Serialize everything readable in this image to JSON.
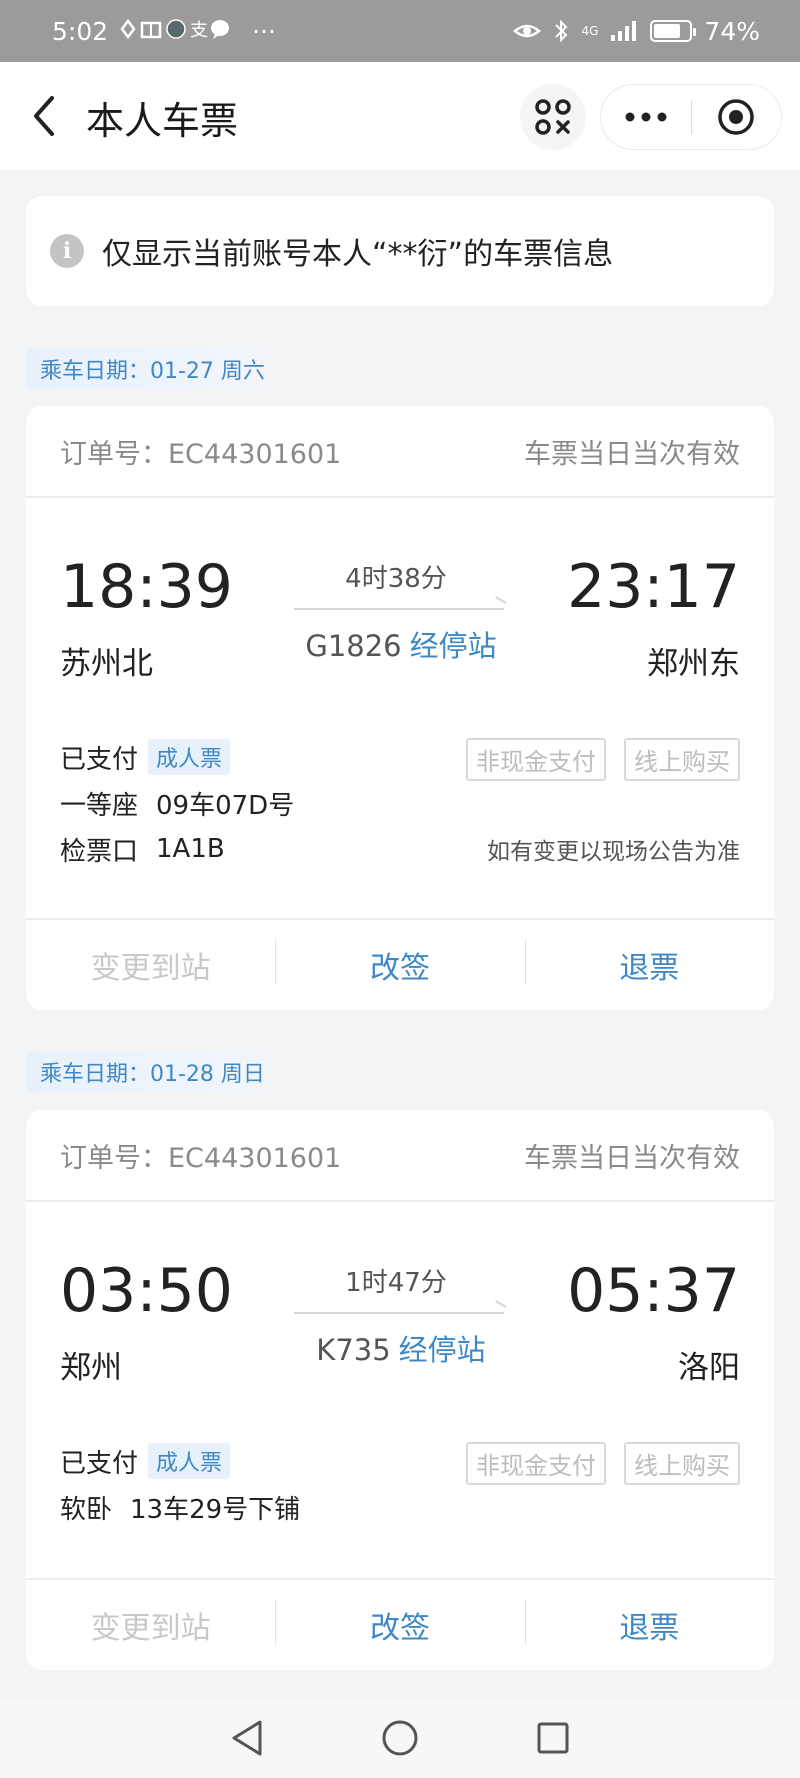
{
  "status_bar": {
    "time": "5:02",
    "more": "···",
    "network": "4G",
    "battery_percent": "74%",
    "battery_level": 0.74
  },
  "header": {
    "title": "本人车票",
    "back_icon": "chevron-left-icon",
    "scan_icon": "scan-icon",
    "more_icon": "more-dots-icon",
    "close_icon": "target-close-icon"
  },
  "notice": {
    "text": "仅显示当前账号本人“**衍”的车票信息"
  },
  "tickets": [
    {
      "date": "乘车日期：01-27 周六",
      "order_no": "订单号：EC44301601",
      "validity": "车票当日当次有效",
      "dep_time": "18:39",
      "arr_time": "23:17",
      "duration": "4时38分",
      "train_no": "G1826",
      "stops_label": "经停站",
      "dep_station": "苏州北",
      "arr_station": "郑州东",
      "pay_status": "已支付",
      "ticket_type": "成人票",
      "pay_tags": [
        "非现金支付",
        "线上购买"
      ],
      "seat_class": "一等座",
      "seat_no": "09车07D号",
      "gate_label": "检票口",
      "gate": "1A1B",
      "gate_note": "如有变更以现场公告为准",
      "actions": [
        "变更到站",
        "改签",
        "退票"
      ]
    },
    {
      "date": "乘车日期：01-28 周日",
      "order_no": "订单号：EC44301601",
      "validity": "车票当日当次有效",
      "dep_time": "03:50",
      "arr_time": "05:37",
      "duration": "1时47分",
      "train_no": "K735",
      "stops_label": "经停站",
      "dep_station": "郑州",
      "arr_station": "洛阳",
      "pay_status": "已支付",
      "ticket_type": "成人票",
      "pay_tags": [
        "非现金支付",
        "线上购买"
      ],
      "seat_class": "软卧",
      "seat_no": "13车29号下铺",
      "actions": [
        "变更到站",
        "改签",
        "退票"
      ]
    }
  ],
  "nav_bar": {
    "back_icon": "nav-back-triangle-icon",
    "home_icon": "nav-home-circle-icon",
    "recents_icon": "nav-recents-square-icon"
  },
  "colors": {
    "accent": "#3f88c8",
    "status_bar_bg": "#9b9b9b",
    "page_bg": "#f3f4f6"
  }
}
